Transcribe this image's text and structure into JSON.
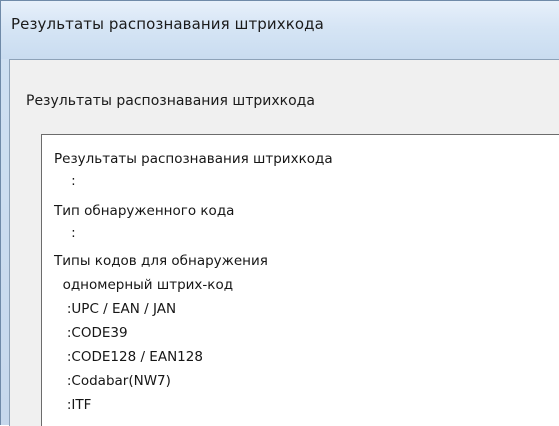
{
  "window": {
    "title": "Результаты распознавания штрихкода"
  },
  "dialog": {
    "group_label": "Результаты распознавания штрихкода",
    "results_text": {
      "lines": [
        "Результаты распознавания штрихкода",
        "    :",
        "Тип обнаруженного кода",
        "    :",
        "Типы кодов для обнаружения",
        "  одномерный штрих-код",
        "   :UPC / EAN / JAN",
        "   :CODE39",
        "   :CODE128 / EAN128",
        "   :Codabar(NW7)",
        "   :ITF"
      ]
    }
  }
}
